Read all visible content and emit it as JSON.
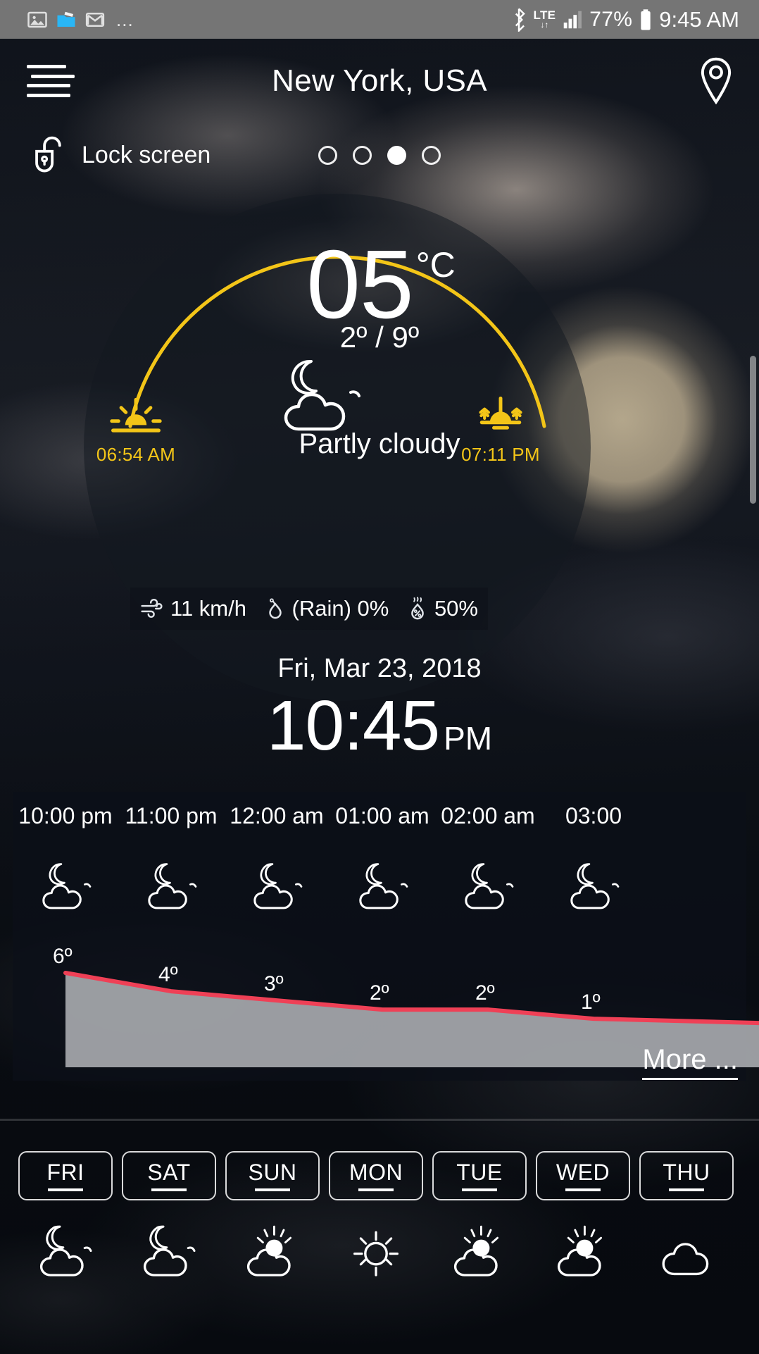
{
  "status_bar": {
    "left_icons": [
      "gallery-icon",
      "file-transfer-icon",
      "gmail-icon"
    ],
    "overflow": "...",
    "bluetooth_icon": "bluetooth-icon",
    "network_label": "LTE",
    "network_arrows": "↓↑",
    "signal_icon": "signal-bars-icon",
    "battery_percent": "77%",
    "battery_icon": "battery-icon",
    "time": "9:45 AM"
  },
  "header": {
    "menu_icon": "hamburger-menu-icon",
    "title": "New York, USA",
    "location_icon": "location-pin-icon"
  },
  "lock_row": {
    "icon": "unlocked-padlock-icon",
    "label": "Lock screen",
    "page_dots_count": 4,
    "page_dot_active_index": 2
  },
  "current": {
    "temperature": "05",
    "unit": "°C",
    "high_low": "2º / 9º",
    "condition": "Partly cloudy",
    "condition_icon": "moon-behind-cloud-icon",
    "sunrise": {
      "icon": "sunrise-icon",
      "time": "06:54 AM"
    },
    "sunset": {
      "icon": "sunset-icon",
      "time": "07:11 PM"
    },
    "stats": [
      {
        "icon": "wind-icon",
        "value": "11 km/h"
      },
      {
        "icon": "raindrop-icon",
        "value": "(Rain) 0%"
      },
      {
        "icon": "humidity-icon",
        "value": "50%"
      }
    ],
    "date": "Fri, Mar 23, 2018",
    "clock": "10:45",
    "meridiem": "PM"
  },
  "hourly": {
    "more_label": "More ...",
    "entries": [
      {
        "time": "10:00 pm",
        "icon": "moon-behind-cloud-icon",
        "temp": "6º"
      },
      {
        "time": "11:00 pm",
        "icon": "moon-behind-cloud-icon",
        "temp": "4º"
      },
      {
        "time": "12:00 am",
        "icon": "moon-behind-cloud-icon",
        "temp": "3º"
      },
      {
        "time": "01:00 am",
        "icon": "moon-behind-cloud-icon",
        "temp": "2º"
      },
      {
        "time": "02:00 am",
        "icon": "moon-behind-cloud-icon",
        "temp": "2º"
      },
      {
        "time": "03:00",
        "icon": "moon-behind-cloud-icon",
        "temp": "1º"
      }
    ]
  },
  "daily": [
    {
      "label": "FRI",
      "icon": "moon-behind-cloud-icon"
    },
    {
      "label": "SAT",
      "icon": "moon-behind-cloud-icon"
    },
    {
      "label": "SUN",
      "icon": "sun-behind-cloud-icon"
    },
    {
      "label": "MON",
      "icon": "sun-icon"
    },
    {
      "label": "TUE",
      "icon": "sun-behind-cloud-icon"
    },
    {
      "label": "WED",
      "icon": "sun-behind-cloud-icon"
    },
    {
      "label": "THU",
      "icon": "cloud-icon"
    }
  ],
  "colors": {
    "accent_yellow": "#f3c518",
    "graph_line": "#ef4056",
    "graph_fill": "#b9bcc0",
    "status_bar_bg": "#757575",
    "panel_bg": "rgba(12,16,24,0.78)"
  },
  "chart_data": {
    "type": "area",
    "title": "Hourly temperature forecast",
    "x": [
      "10:00 pm",
      "11:00 pm",
      "12:00 am",
      "01:00 am",
      "02:00 am",
      "03:00"
    ],
    "values": [
      6,
      4,
      3,
      2,
      2,
      1
    ],
    "labels": [
      "6º",
      "4º",
      "3º",
      "2º",
      "2º",
      "1º"
    ],
    "ylabel": "ºC",
    "xlabel": "",
    "ylim": [
      0,
      7
    ],
    "grid": false,
    "legend": "none",
    "line_color": "#ef4056",
    "fill_color": "#b9bcc0"
  }
}
